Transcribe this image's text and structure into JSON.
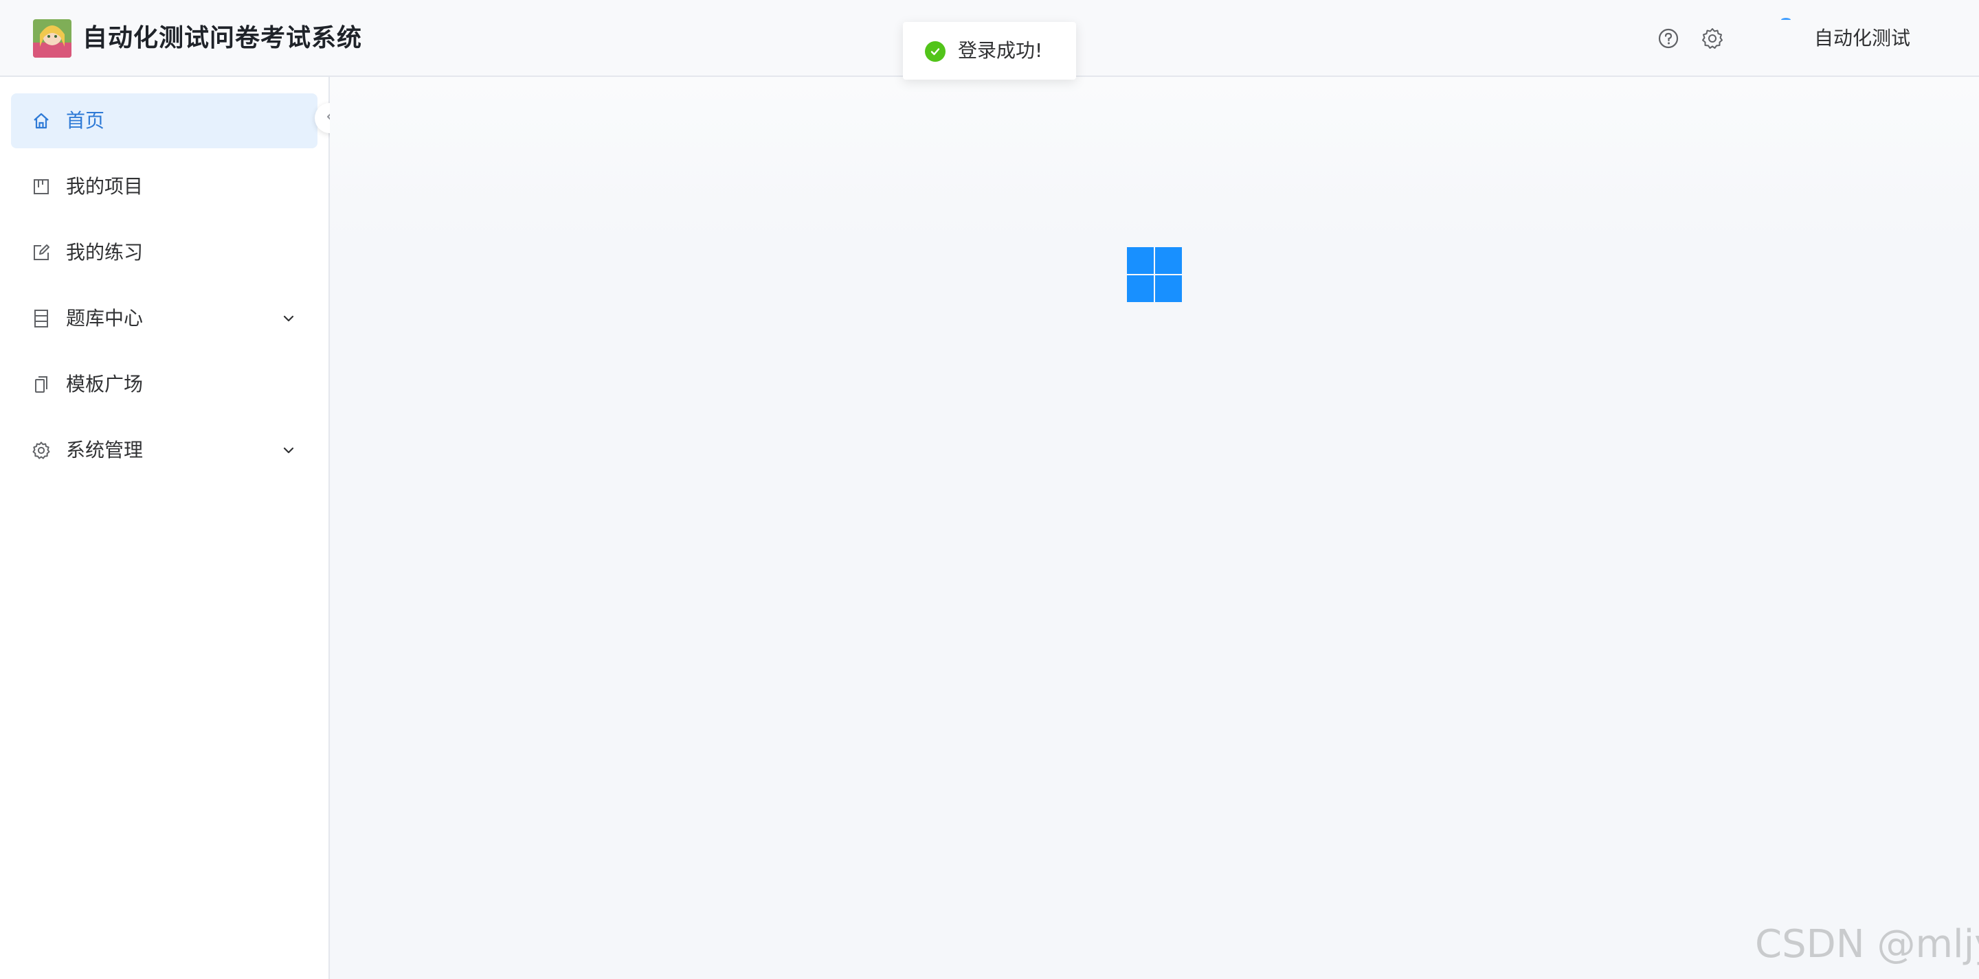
{
  "header": {
    "app_title": "自动化测试问卷考试系统",
    "user_name": "自动化测试",
    "help_icon": "help-circle-icon",
    "settings_icon": "gear-icon"
  },
  "sidebar": {
    "items": [
      {
        "label": "首页",
        "icon": "home-icon",
        "active": true
      },
      {
        "label": "我的项目",
        "icon": "project-icon"
      },
      {
        "label": "我的练习",
        "icon": "edit-icon"
      },
      {
        "label": "题库中心",
        "icon": "database-icon",
        "expandable": true
      },
      {
        "label": "模板广场",
        "icon": "copy-icon"
      },
      {
        "label": "系统管理",
        "icon": "gear-icon",
        "expandable": true
      }
    ]
  },
  "toast": {
    "message": "登录成功!",
    "icon": "check-circle-icon",
    "color": "#52c41a"
  },
  "loader": {
    "color": "#1890ff"
  },
  "watermark": "CSDN @mljy.",
  "colors": {
    "accent": "#2e7ad6",
    "active_bg": "#e6f1fd"
  }
}
